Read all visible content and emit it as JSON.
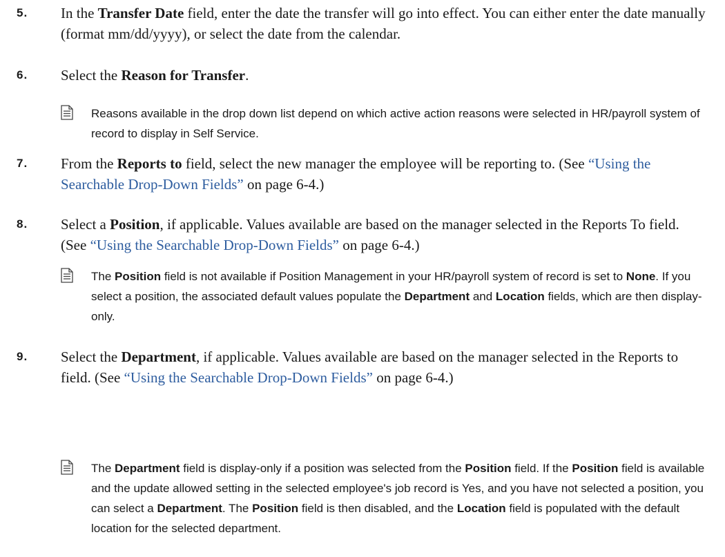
{
  "steps": [
    {
      "num": "5.",
      "segments": [
        {
          "t": "In the ",
          "k": "text"
        },
        {
          "t": "Transfer Date",
          "k": "bold"
        },
        {
          "t": " field, enter the date the transfer will go into effect. You can either enter the date manually (format mm/dd/yyyy), or select the date from the calendar.",
          "k": "text"
        }
      ]
    },
    {
      "num": "6.",
      "segments": [
        {
          "t": "Select the ",
          "k": "text"
        },
        {
          "t": "Reason for Transfer",
          "k": "bold"
        },
        {
          "t": ".",
          "k": "text"
        }
      ],
      "note": [
        {
          "t": "Reasons available in the drop down list depend on which active action reasons were selected in HR/payroll system of record to display in Self Service.",
          "k": "text"
        }
      ]
    },
    {
      "num": "7.",
      "segments": [
        {
          "t": "From the ",
          "k": "text"
        },
        {
          "t": "Reports to",
          "k": "bold"
        },
        {
          "t": " field, select the new manager the employee will be reporting to. (See ",
          "k": "text"
        },
        {
          "t": "“Using the Searchable Drop-Down Fields”",
          "k": "link"
        },
        {
          "t": " on page 6-4.)",
          "k": "text"
        }
      ]
    },
    {
      "num": "8.",
      "segments": [
        {
          "t": "Select a ",
          "k": "text"
        },
        {
          "t": "Position",
          "k": "bold"
        },
        {
          "t": ", if applicable. Values available are based on the manager selected in the Reports To field. (See ",
          "k": "text"
        },
        {
          "t": "“Using the Searchable Drop-Down Fields”",
          "k": "link"
        },
        {
          "t": " on page 6-4.)",
          "k": "text"
        }
      ],
      "note": [
        {
          "t": "The ",
          "k": "text"
        },
        {
          "t": "Position",
          "k": "bold"
        },
        {
          "t": " field is not available if Position Management in your HR/payroll system of record is set to ",
          "k": "text"
        },
        {
          "t": "None",
          "k": "bold"
        },
        {
          "t": ". If you select a position, the associated default values populate the ",
          "k": "text"
        },
        {
          "t": "Department",
          "k": "bold"
        },
        {
          "t": " and ",
          "k": "text"
        },
        {
          "t": "Location",
          "k": "bold"
        },
        {
          "t": " fields, which are then display-only.",
          "k": "text"
        }
      ]
    },
    {
      "num": "9.",
      "segments": [
        {
          "t": "Select the ",
          "k": "text"
        },
        {
          "t": "Department",
          "k": "bold"
        },
        {
          "t": ", if applicable. Values available are based on the manager selected in the Reports to field. (See ",
          "k": "text"
        },
        {
          "t": "“Using the Searchable Drop-Down Fields”",
          "k": "link"
        },
        {
          "t": " on page 6-4.)",
          "k": "text"
        }
      ],
      "note": [
        {
          "t": "The ",
          "k": "text"
        },
        {
          "t": "Department",
          "k": "bold"
        },
        {
          "t": " field is display-only if a position was selected from the ",
          "k": "text"
        },
        {
          "t": "Position",
          "k": "bold"
        },
        {
          "t": " field. If the ",
          "k": "text"
        },
        {
          "t": "Position",
          "k": "bold"
        },
        {
          "t": " field is available and the update allowed setting in the selected employee's job record is Yes, and you have not selected a position, you can select a ",
          "k": "text"
        },
        {
          "t": "Department",
          "k": "bold"
        },
        {
          "t": ". The ",
          "k": "text"
        },
        {
          "t": "Position",
          "k": "bold"
        },
        {
          "t": " field is then disabled, and the ",
          "k": "text"
        },
        {
          "t": "Location",
          "k": "bold"
        },
        {
          "t": " field is populated with the default location for the selected department.",
          "k": "text"
        }
      ]
    }
  ]
}
